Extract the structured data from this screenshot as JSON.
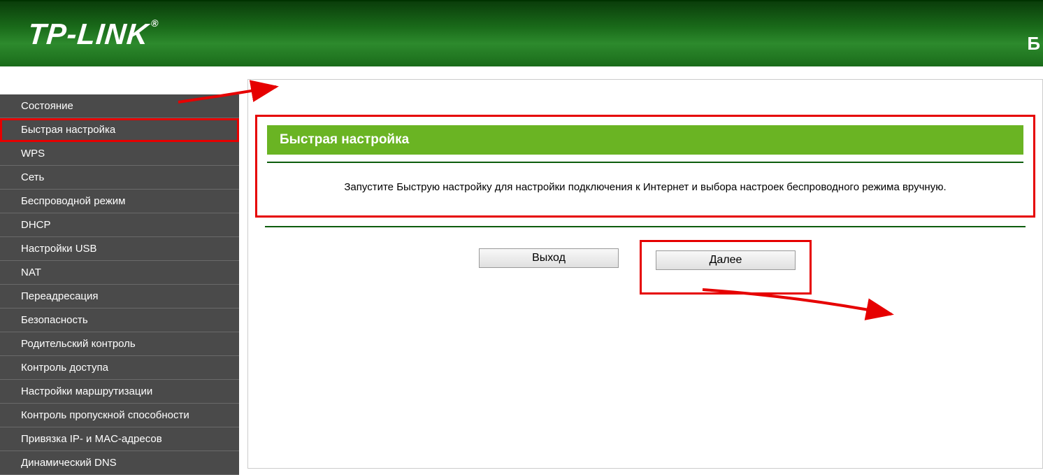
{
  "header": {
    "logo_text": "TP-LINK",
    "logo_reg": "®",
    "right_letter": "Б"
  },
  "sidebar": {
    "items": [
      {
        "label": "Состояние"
      },
      {
        "label": "Быстрая настройка",
        "highlighted": true
      },
      {
        "label": "WPS"
      },
      {
        "label": "Сеть"
      },
      {
        "label": "Беспроводной режим"
      },
      {
        "label": "DHCP"
      },
      {
        "label": "Настройки USB"
      },
      {
        "label": "NAT"
      },
      {
        "label": "Переадресация"
      },
      {
        "label": "Безопасность"
      },
      {
        "label": "Родительский контроль"
      },
      {
        "label": "Контроль доступа"
      },
      {
        "label": "Настройки маршрутизации"
      },
      {
        "label": "Контроль пропускной способности"
      },
      {
        "label": "Привязка IP- и MAC-адресов"
      },
      {
        "label": "Динамический DNS"
      }
    ]
  },
  "content": {
    "panel_title": "Быстрая настройка",
    "instruction": "Запустите Быструю настройку для настройки подключения к Интернет и выбора настроек беспроводного режима вручную.",
    "exit_label": "Выход",
    "next_label": "Далее"
  },
  "colors": {
    "highlight_red": "#e60000",
    "panel_green": "#6ab423",
    "dark_green": "#0d5d0d"
  }
}
